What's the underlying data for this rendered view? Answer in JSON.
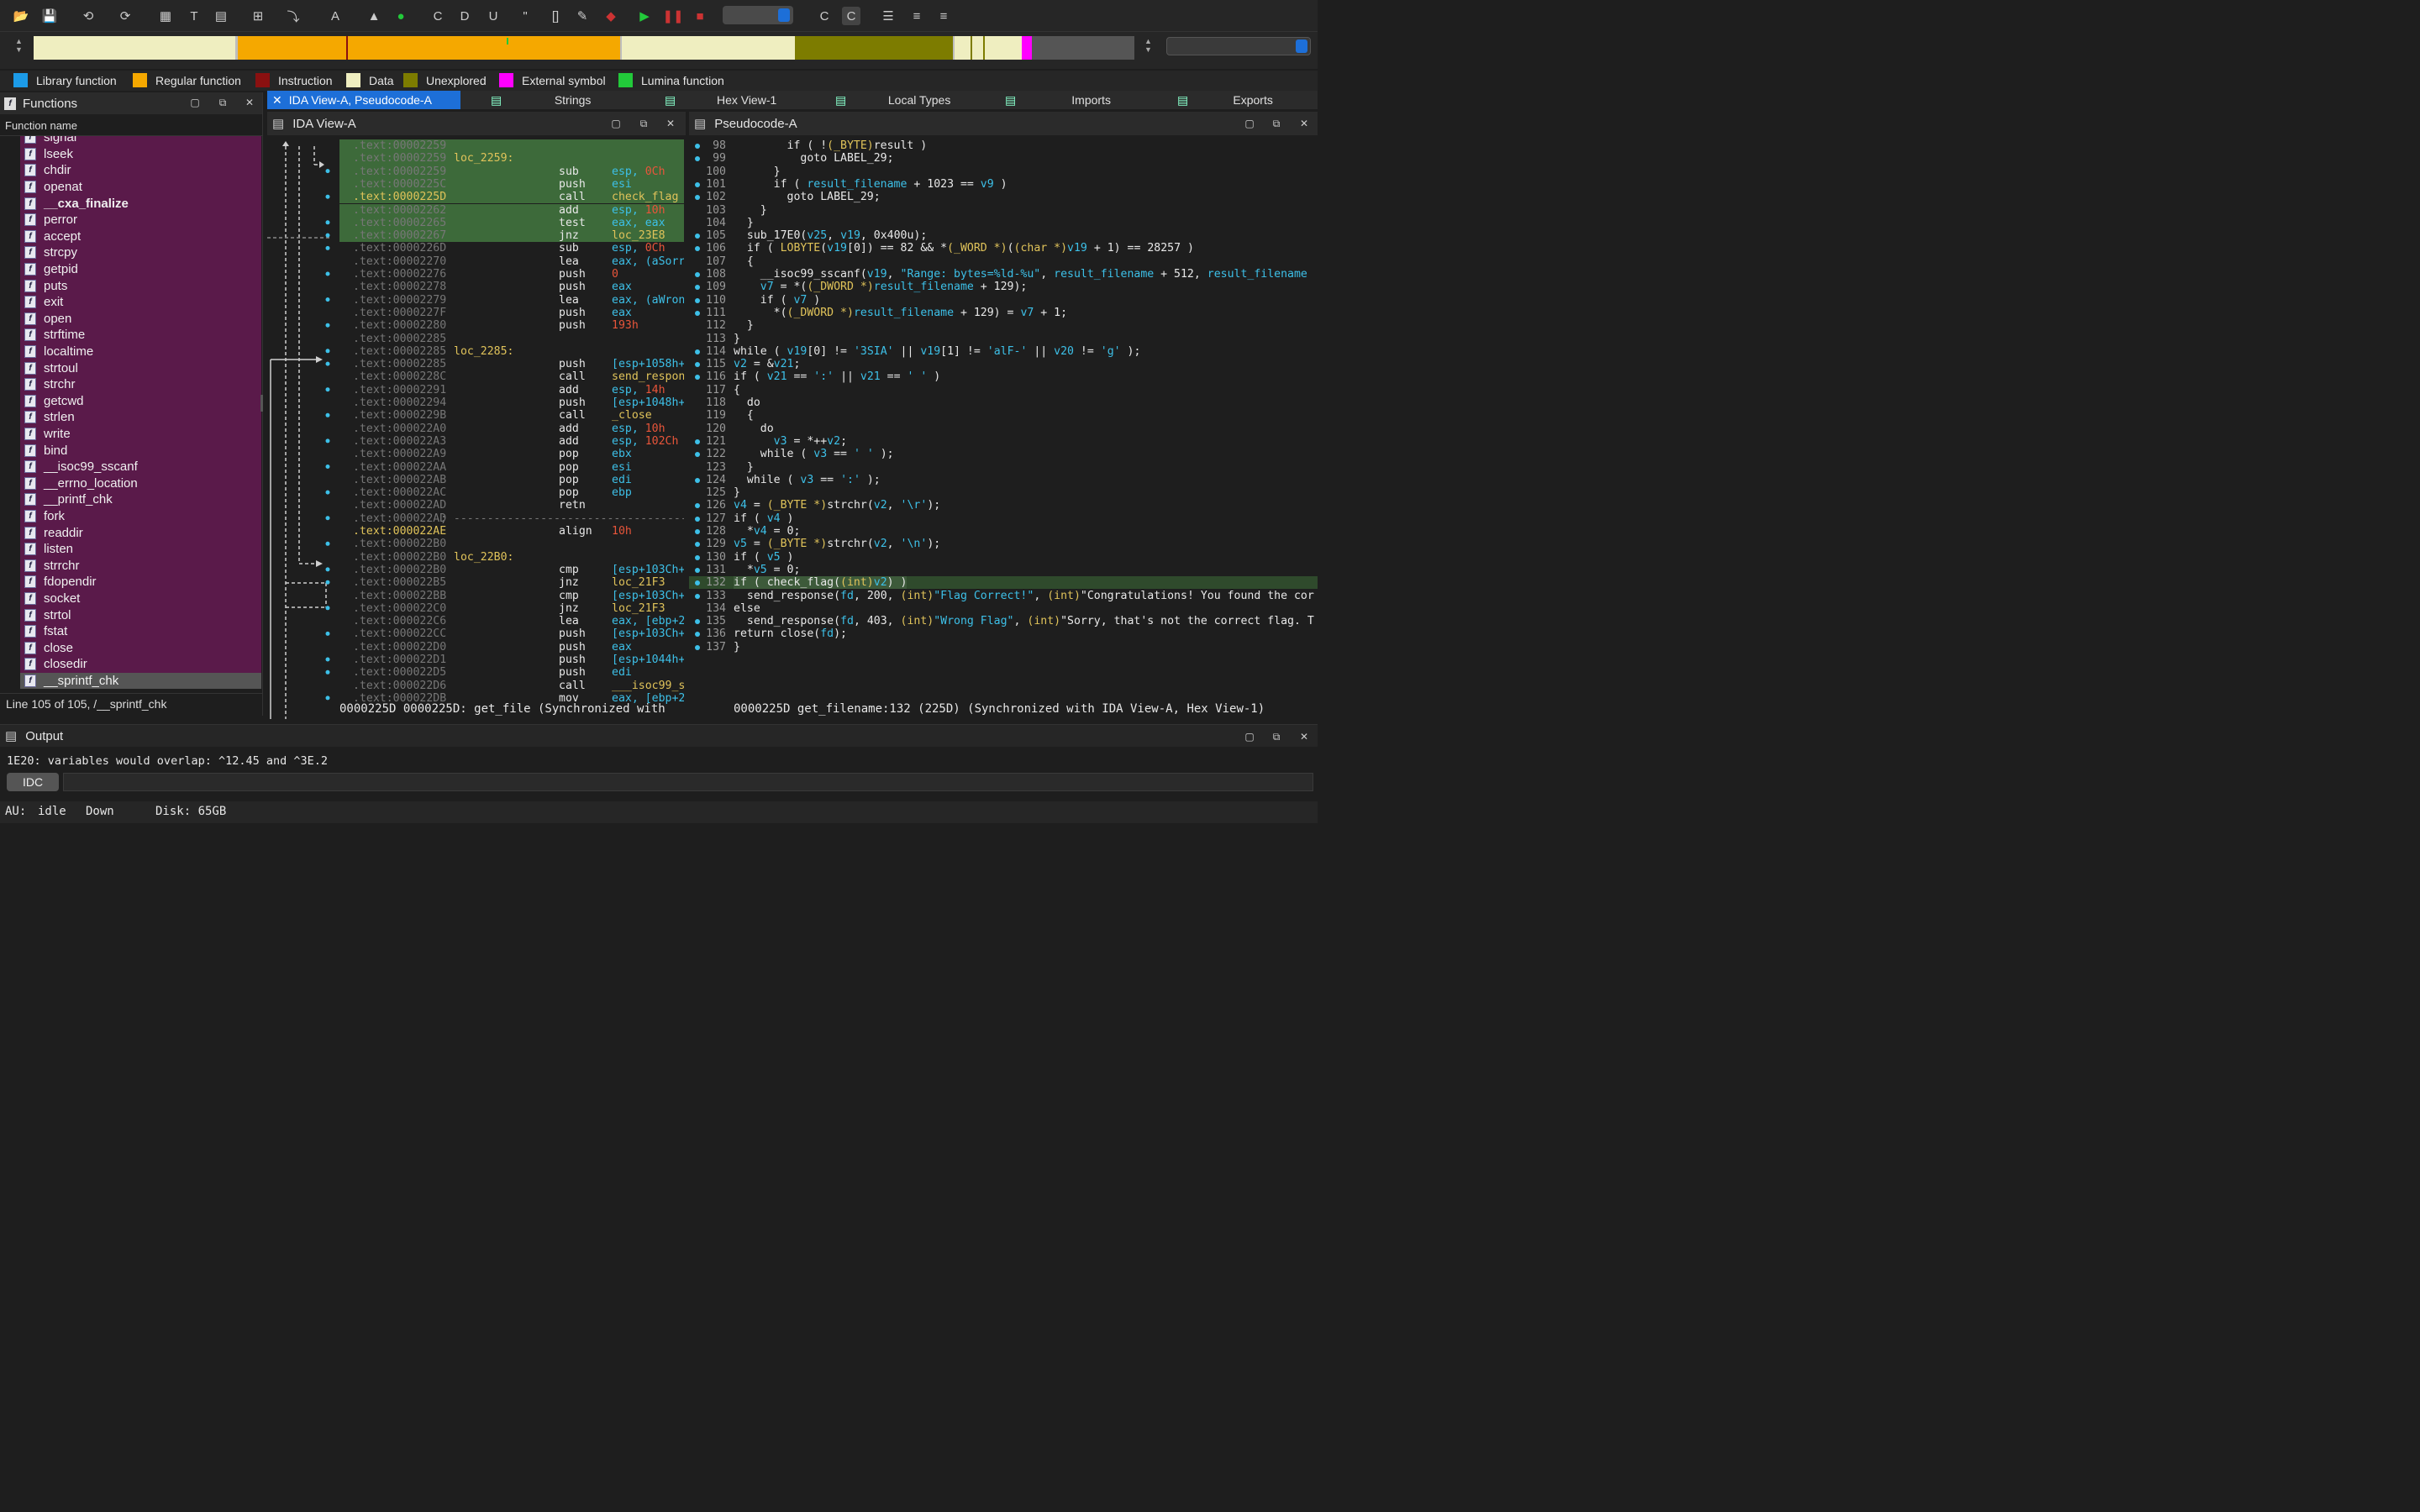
{
  "colors": {
    "library": "#1c9be8",
    "regular": "#f5a800",
    "instruction": "#8a1010",
    "data": "#efeec0",
    "unexplored": "#7d7c00",
    "external": "#ff00ff",
    "lumina": "#22c93a"
  },
  "legend": [
    {
      "label": "Library function",
      "color": "#1c9be8"
    },
    {
      "label": "Regular function",
      "color": "#f5a800"
    },
    {
      "label": "Instruction",
      "color": "#8a1010"
    },
    {
      "label": "Data",
      "color": "#efeec0"
    },
    {
      "label": "Unexplored",
      "color": "#7d7c00"
    },
    {
      "label": "External symbol",
      "color": "#ff00ff"
    },
    {
      "label": "Lumina function",
      "color": "#22c93a"
    }
  ],
  "functions": {
    "title": "Functions",
    "column": "Function name",
    "items": [
      "signal",
      "lseek",
      "chdir",
      "openat",
      "__cxa_finalize",
      "perror",
      "accept",
      "strcpy",
      "getpid",
      "puts",
      "exit",
      "open",
      "strftime",
      "localtime",
      "strtoul",
      "strchr",
      "getcwd",
      "strlen",
      "write",
      "bind",
      "__isoc99_sscanf",
      "__errno_location",
      "__printf_chk",
      "fork",
      "readdir",
      "listen",
      "strrchr",
      "fdopendir",
      "socket",
      "strtol",
      "fstat",
      "close",
      "closedir",
      "__sprintf_chk"
    ],
    "selected": "__sprintf_chk",
    "status": "Line 105 of 105, /__sprintf_chk"
  },
  "tabs": [
    "IDA View-A, Pseudocode-A",
    "Strings",
    "Hex View-1",
    "Local Types",
    "Imports",
    "Exports"
  ],
  "ida": {
    "title": "IDA View-A",
    "status": "0000225D 0000225D: get_file (Synchronized with",
    "lines": [
      {
        "addr": ".text:00002259",
        "lbl": "",
        "mn": "",
        "op": "",
        "hl": true
      },
      {
        "addr": ".text:00002259",
        "lbl": "loc_2259:",
        "mn": "",
        "op": "",
        "hl": true
      },
      {
        "addr": ".text:00002259",
        "lbl": "",
        "mn": "sub",
        "op": "esp, |0Ch",
        "hl": true
      },
      {
        "addr": ".text:0000225C",
        "lbl": "",
        "mn": "push",
        "op": "esi",
        "hl": true
      },
      {
        "addr": ".text:0000225D",
        "lbl": "",
        "mn": "call",
        "op": "~check_flag",
        "hl": true,
        "yaddr": true
      },
      {
        "addr": ".text:00002262",
        "lbl": "",
        "mn": "add",
        "op": "esp, |10h",
        "hl": true
      },
      {
        "addr": ".text:00002265",
        "lbl": "",
        "mn": "test",
        "op": "eax, eax",
        "hl": true
      },
      {
        "addr": ".text:00002267",
        "lbl": "",
        "mn": "jnz",
        "op": "~loc_23E8",
        "hl": true
      },
      {
        "addr": ".text:0000226D",
        "lbl": "",
        "mn": "sub",
        "op": "esp, |0Ch"
      },
      {
        "addr": ".text:00002270",
        "lbl": "",
        "mn": "lea",
        "op": "eax, (aSorr"
      },
      {
        "addr": ".text:00002276",
        "lbl": "",
        "mn": "push",
        "op": "|0"
      },
      {
        "addr": ".text:00002278",
        "lbl": "",
        "mn": "push",
        "op": "eax"
      },
      {
        "addr": ".text:00002279",
        "lbl": "",
        "mn": "lea",
        "op": "eax, (aWron"
      },
      {
        "addr": ".text:0000227F",
        "lbl": "",
        "mn": "push",
        "op": "eax"
      },
      {
        "addr": ".text:00002280",
        "lbl": "",
        "mn": "push",
        "op": "|193h"
      },
      {
        "addr": ".text:00002285",
        "lbl": "",
        "mn": "",
        "op": ""
      },
      {
        "addr": ".text:00002285",
        "lbl": "loc_2285:",
        "mn": "",
        "op": ""
      },
      {
        "addr": ".text:00002285",
        "lbl": "",
        "mn": "push",
        "op": "[esp+1058h+"
      },
      {
        "addr": ".text:0000228C",
        "lbl": "",
        "mn": "call",
        "op": "~send_respon"
      },
      {
        "addr": ".text:00002291",
        "lbl": "",
        "mn": "add",
        "op": "esp, |14h"
      },
      {
        "addr": ".text:00002294",
        "lbl": "",
        "mn": "push",
        "op": "[esp+1048h+"
      },
      {
        "addr": ".text:0000229B",
        "lbl": "",
        "mn": "call",
        "op": "~_close"
      },
      {
        "addr": ".text:000022A0",
        "lbl": "",
        "mn": "add",
        "op": "esp, |10h"
      },
      {
        "addr": ".text:000022A3",
        "lbl": "",
        "mn": "add",
        "op": "esp, |102Ch"
      },
      {
        "addr": ".text:000022A9",
        "lbl": "",
        "mn": "pop",
        "op": "ebx"
      },
      {
        "addr": ".text:000022AA",
        "lbl": "",
        "mn": "pop",
        "op": "esi"
      },
      {
        "addr": ".text:000022AB",
        "lbl": "",
        "mn": "pop",
        "op": "edi"
      },
      {
        "addr": ".text:000022AC",
        "lbl": "",
        "mn": "pop",
        "op": "ebp"
      },
      {
        "addr": ".text:000022AD",
        "lbl": "",
        "mn": "retn",
        "op": ""
      },
      {
        "addr": ".text:000022AD",
        "lbl": "; ---------------------------------------------",
        "mn": "",
        "op": "",
        "sepline": true
      },
      {
        "addr": ".text:000022AE",
        "lbl": "",
        "mn": "align",
        "op": "|10h",
        "yaddr": true
      },
      {
        "addr": ".text:000022B0",
        "lbl": "",
        "mn": "",
        "op": ""
      },
      {
        "addr": ".text:000022B0",
        "lbl": "loc_22B0:",
        "mn": "",
        "op": ""
      },
      {
        "addr": ".text:000022B0",
        "lbl": "",
        "mn": "cmp",
        "op": "[esp+103Ch+"
      },
      {
        "addr": ".text:000022B5",
        "lbl": "",
        "mn": "jnz",
        "op": "~loc_21F3"
      },
      {
        "addr": ".text:000022BB",
        "lbl": "",
        "mn": "cmp",
        "op": "[esp+103Ch+"
      },
      {
        "addr": ".text:000022C0",
        "lbl": "",
        "mn": "jnz",
        "op": "~loc_21F3"
      },
      {
        "addr": ".text:000022C6",
        "lbl": "",
        "mn": "lea",
        "op": "eax, [ebp+2"
      },
      {
        "addr": ".text:000022CC",
        "lbl": "",
        "mn": "push",
        "op": "[esp+103Ch+"
      },
      {
        "addr": ".text:000022D0",
        "lbl": "",
        "mn": "push",
        "op": "eax"
      },
      {
        "addr": ".text:000022D1",
        "lbl": "",
        "mn": "push",
        "op": "[esp+1044h+"
      },
      {
        "addr": ".text:000022D5",
        "lbl": "",
        "mn": "push",
        "op": "edi"
      },
      {
        "addr": ".text:000022D6",
        "lbl": "",
        "mn": "call",
        "op": "~___isoc99_s"
      },
      {
        "addr": ".text:000022DB",
        "lbl": "",
        "mn": "mov",
        "op": "eax, [ebp+2"
      }
    ]
  },
  "pseudo": {
    "title": "Pseudocode-A",
    "status": "0000225D get_filename:132 (225D) (Synchronized with IDA View-A, Hex View-1)",
    "lines": [
      {
        "n": "98",
        "dot": true,
        "code": "        if ( !(_BYTE)result )"
      },
      {
        "n": "99",
        "dot": true,
        "code": "          goto LABEL_29;"
      },
      {
        "n": "100",
        "dot": false,
        "code": "      }"
      },
      {
        "n": "101",
        "dot": true,
        "code": "      if ( result_filename + 1023 == v9 )"
      },
      {
        "n": "102",
        "dot": true,
        "code": "        goto LABEL_29;"
      },
      {
        "n": "103",
        "dot": false,
        "code": "    }"
      },
      {
        "n": "104",
        "dot": false,
        "code": "  }"
      },
      {
        "n": "105",
        "dot": true,
        "code": "  sub_17E0(v25, v19, 0x400u);"
      },
      {
        "n": "106",
        "dot": true,
        "code": "  if ( LOBYTE(v19[0]) == 82 && *(_WORD *)((char *)v19 + 1) == 28257 )"
      },
      {
        "n": "107",
        "dot": false,
        "code": "  {"
      },
      {
        "n": "108",
        "dot": true,
        "code": "    __isoc99_sscanf(v19, \"Range: bytes=%ld-%u\", result_filename + 512, result_filename"
      },
      {
        "n": "109",
        "dot": true,
        "code": "    v7 = *((_DWORD *)result_filename + 129);"
      },
      {
        "n": "110",
        "dot": true,
        "code": "    if ( v7 )"
      },
      {
        "n": "111",
        "dot": true,
        "code": "      *((_DWORD *)result_filename + 129) = v7 + 1;"
      },
      {
        "n": "112",
        "dot": false,
        "code": "  }"
      },
      {
        "n": "113",
        "dot": false,
        "code": "}"
      },
      {
        "n": "114",
        "dot": true,
        "code": "while ( v19[0] != '3SIA' || v19[1] != 'alF-' || v20 != 'g' );"
      },
      {
        "n": "115",
        "dot": true,
        "code": "v2 = &v21;"
      },
      {
        "n": "116",
        "dot": true,
        "code": "if ( v21 == ':' || v21 == ' ' )"
      },
      {
        "n": "117",
        "dot": false,
        "code": "{"
      },
      {
        "n": "118",
        "dot": false,
        "code": "  do"
      },
      {
        "n": "119",
        "dot": false,
        "code": "  {"
      },
      {
        "n": "120",
        "dot": false,
        "code": "    do"
      },
      {
        "n": "121",
        "dot": true,
        "code": "      v3 = *++v2;"
      },
      {
        "n": "122",
        "dot": true,
        "code": "    while ( v3 == ' ' );"
      },
      {
        "n": "123",
        "dot": false,
        "code": "  }"
      },
      {
        "n": "124",
        "dot": true,
        "code": "  while ( v3 == ':' );"
      },
      {
        "n": "125",
        "dot": false,
        "code": "}"
      },
      {
        "n": "126",
        "dot": true,
        "code": "v4 = (_BYTE *)strchr(v2, '\\r');"
      },
      {
        "n": "127",
        "dot": true,
        "code": "if ( v4 )"
      },
      {
        "n": "128",
        "dot": true,
        "code": "  *v4 = 0;"
      },
      {
        "n": "129",
        "dot": true,
        "code": "v5 = (_BYTE *)strchr(v2, '\\n');"
      },
      {
        "n": "130",
        "dot": true,
        "code": "if ( v5 )"
      },
      {
        "n": "131",
        "dot": true,
        "code": "  *v5 = 0;"
      },
      {
        "n": "132",
        "dot": true,
        "code": "if ( check_flag((int)v2) )",
        "hl": true
      },
      {
        "n": "133",
        "dot": true,
        "code": "  send_response(fd, 200, (int)\"Flag Correct!\", (int)\"Congratulations! You found the cor"
      },
      {
        "n": "134",
        "dot": false,
        "code": "else"
      },
      {
        "n": "135",
        "dot": true,
        "code": "  send_response(fd, 403, (int)\"Wrong Flag\", (int)\"Sorry, that's not the correct flag. T"
      },
      {
        "n": "136",
        "dot": true,
        "code": "return close(fd);"
      },
      {
        "n": "137",
        "dot": true,
        "code": "}"
      }
    ]
  },
  "output": {
    "title": "Output",
    "line": "1E20: variables would overlap: ^12.45 and ^3E.2",
    "idc": "IDC"
  },
  "status": {
    "au": "AU:",
    "state": "idle",
    "dir": "Down",
    "disk": "Disk: 65GB"
  }
}
